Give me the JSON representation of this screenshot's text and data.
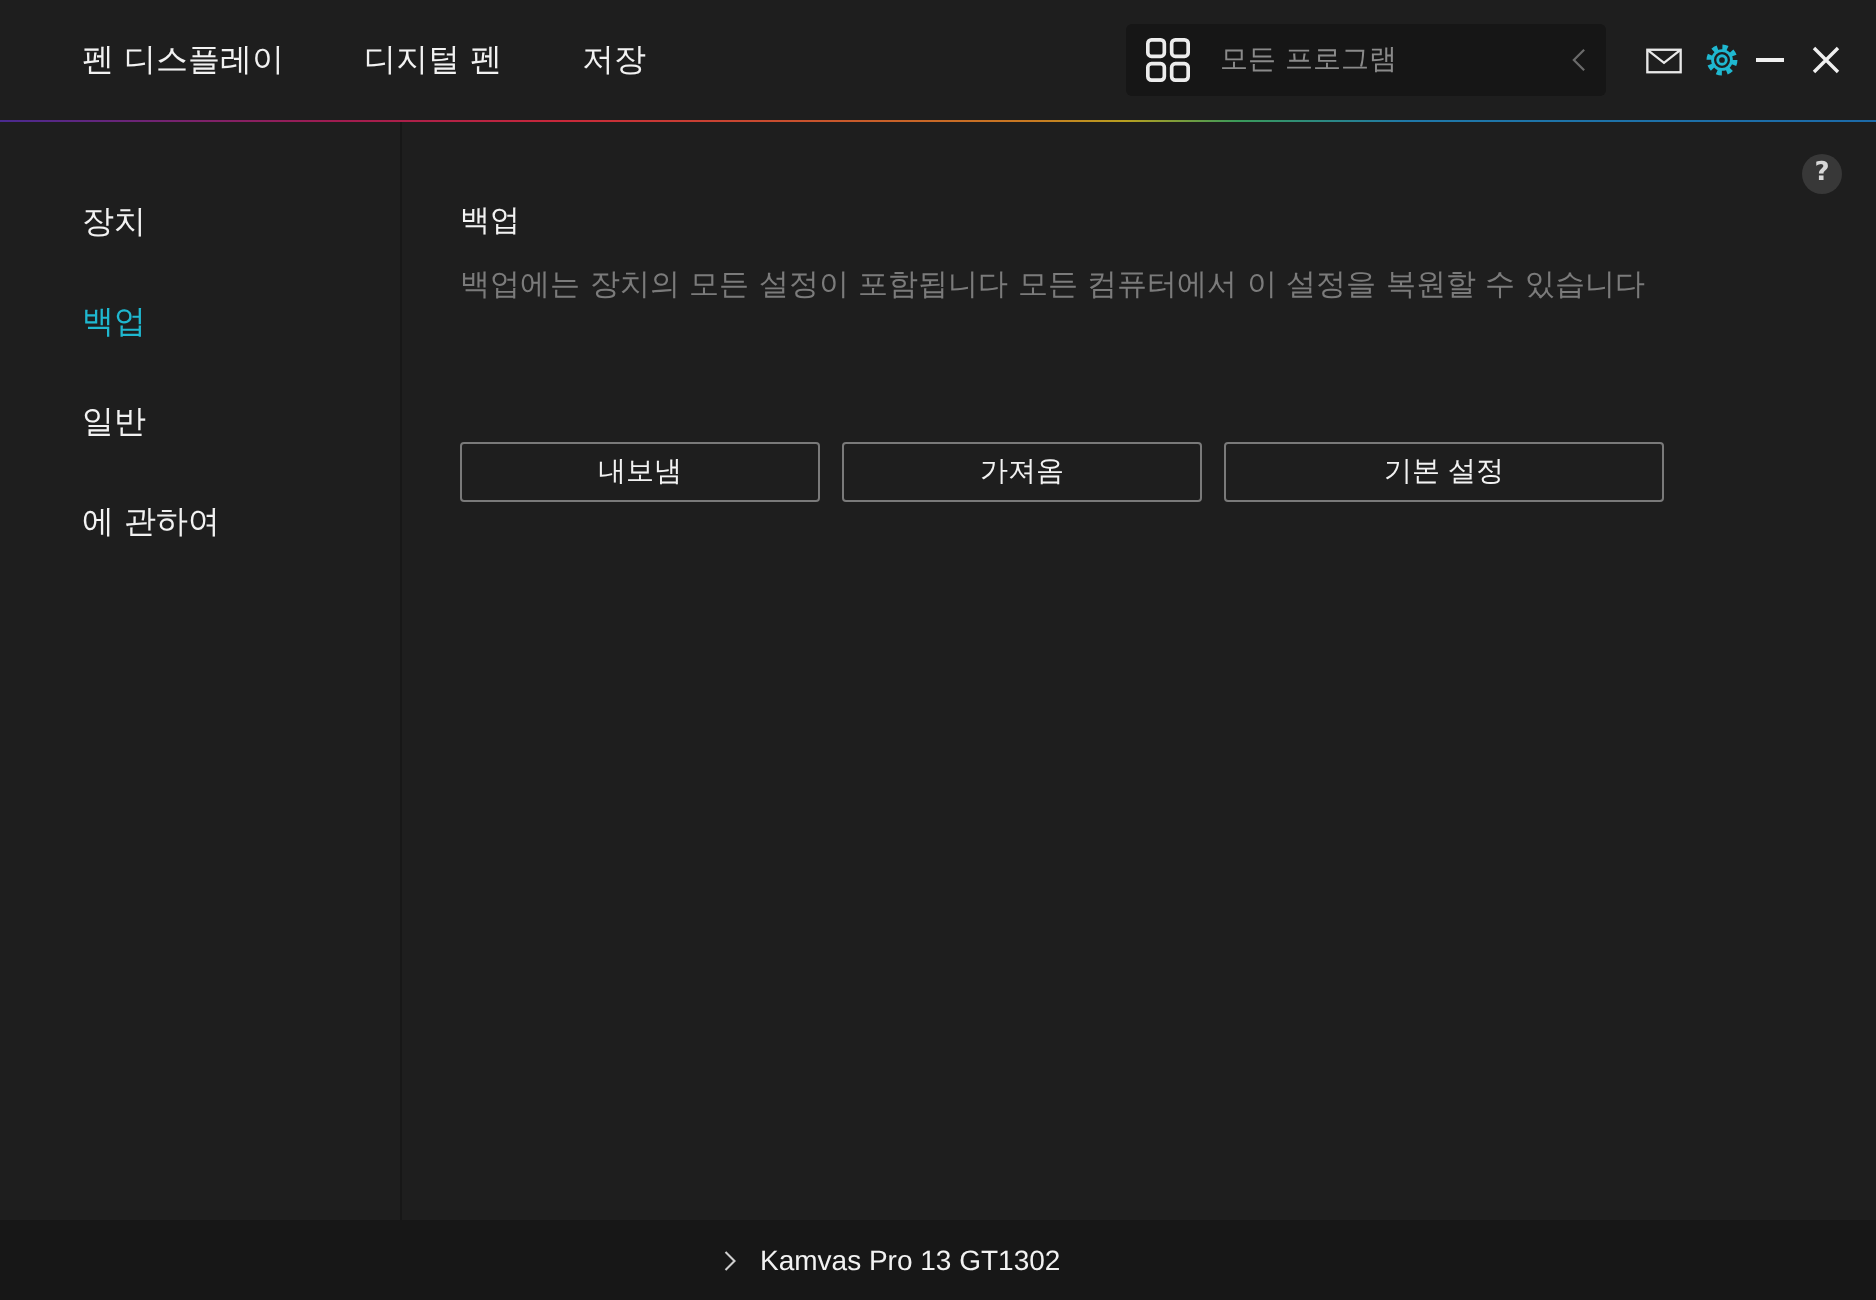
{
  "header": {
    "tabs": [
      {
        "label": "펜 디스플레이",
        "selected": false
      },
      {
        "label": "디지털 펜",
        "selected": false
      },
      {
        "label": "저장",
        "selected": false
      }
    ],
    "program_selector": {
      "value": "모든 프로그램"
    }
  },
  "sidebar": {
    "items": [
      {
        "label": "장치",
        "selected": false
      },
      {
        "label": "백업",
        "selected": true
      },
      {
        "label": "일반",
        "selected": false
      },
      {
        "label": "에 관하여",
        "selected": false
      }
    ]
  },
  "content": {
    "help": "?",
    "title": "백업",
    "description": "백업에는 장치의 모든 설정이 포함됩니다 모든 컴퓨터에서 이 설정을 복원할 수 있습니다",
    "buttons": [
      "내보냄",
      "가져옴",
      "기본 설정"
    ]
  },
  "footer": {
    "device": "Kamvas Pro 13 GT1302"
  }
}
